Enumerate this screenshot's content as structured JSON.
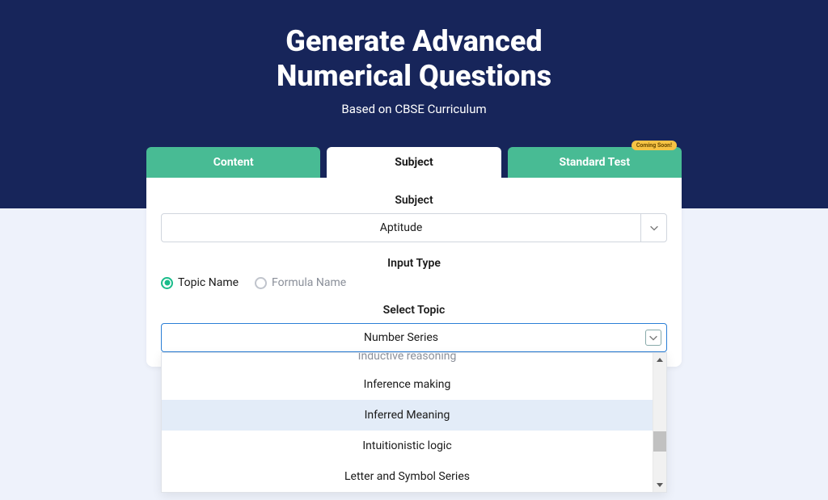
{
  "header": {
    "title_line1": "Generate Advanced",
    "title_line2": "Numerical Questions",
    "subtitle": "Based on CBSE Curriculum"
  },
  "tabs": {
    "content": "Content",
    "subject": "Subject",
    "standard_test": "Standard Test",
    "badge": "Coming Soon!"
  },
  "form": {
    "subject_label": "Subject",
    "subject_value": "Aptitude",
    "input_type_label": "Input Type",
    "radio_topic": "Topic Name",
    "radio_formula": "Formula Name",
    "select_topic_label": "Select Topic",
    "select_topic_value": "Number Series"
  },
  "dropdown": {
    "partial_top": "Inductive reasoning",
    "options": [
      "Inference making",
      "Inferred Meaning",
      "Intuitionistic logic",
      "Letter and Symbol Series"
    ],
    "highlighted_index": 1
  }
}
